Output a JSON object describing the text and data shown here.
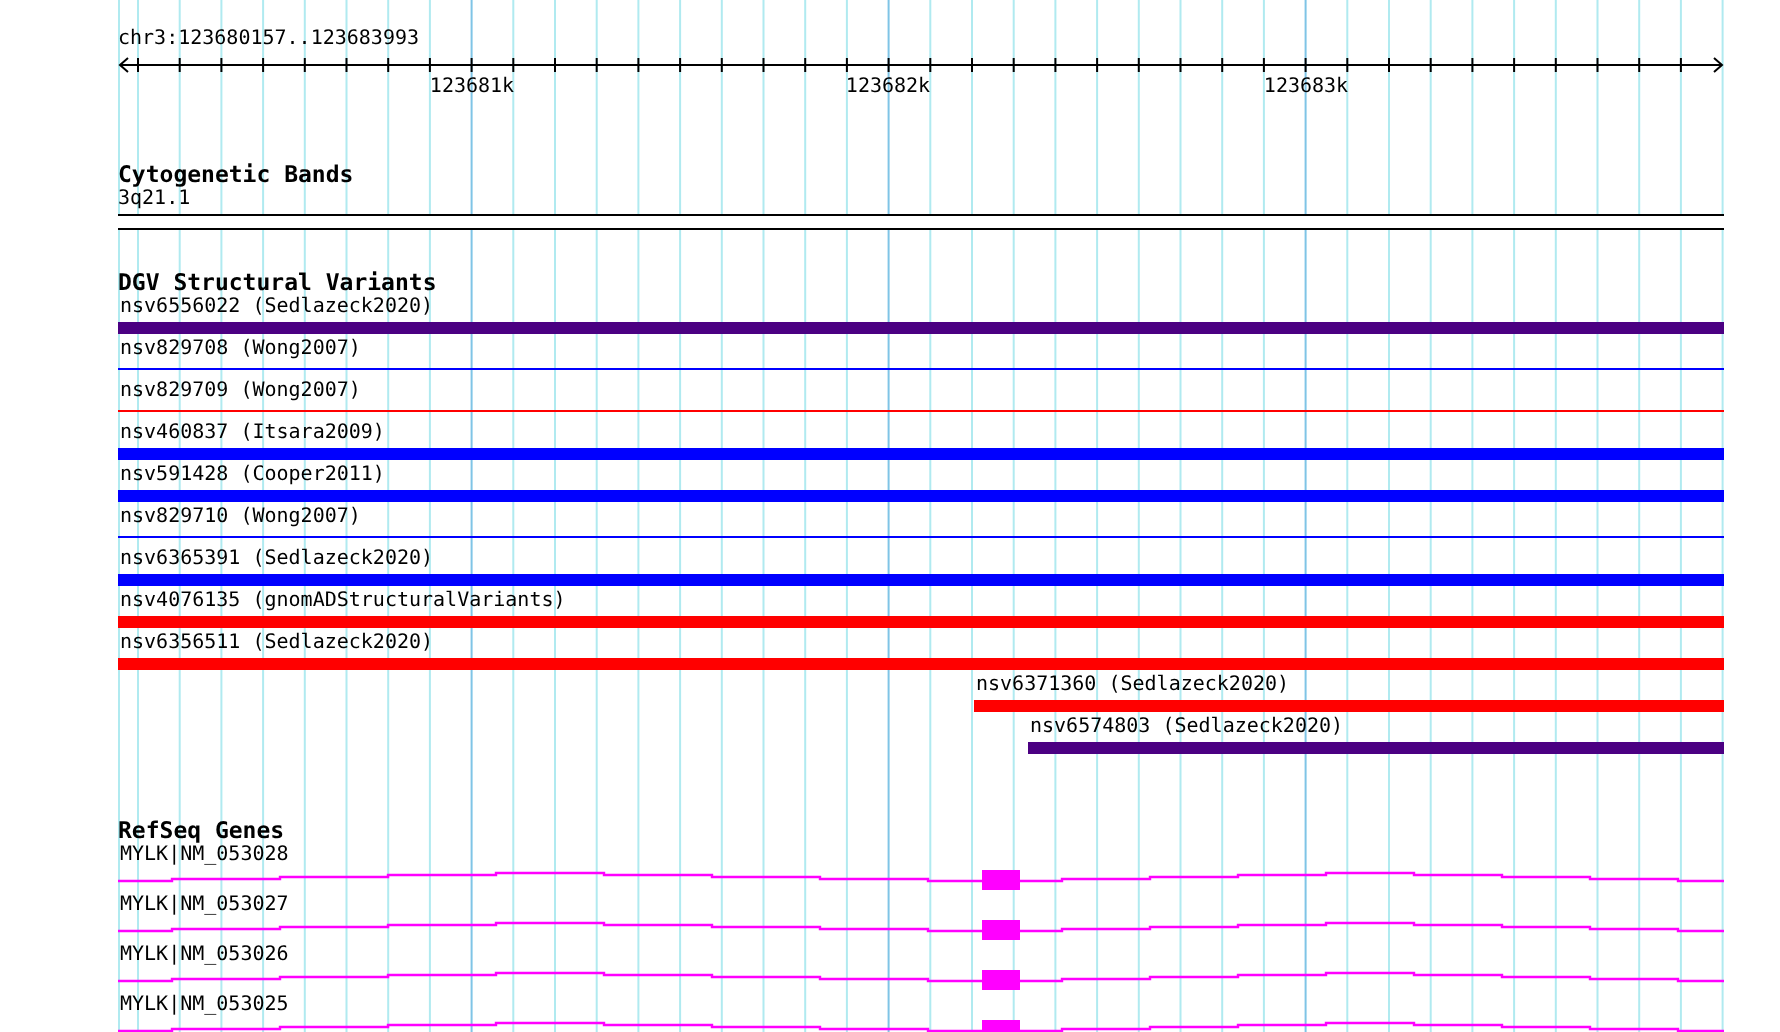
{
  "ruler": {
    "range_label": "chr3:123680157..123683993",
    "ticks": [
      "123681k",
      "123682k",
      "123683k"
    ]
  },
  "tracks": [
    {
      "kind": "bands",
      "title": "Cytogenetic Bands",
      "features": [
        {
          "label": "3q21.1"
        }
      ]
    },
    {
      "kind": "variants",
      "title": "DGV Structural Variants",
      "features": [
        {
          "label": "nsv6556022 (Sedlazeck2020)",
          "kind": "bar",
          "color": "#4b0082"
        },
        {
          "label": "nsv829708 (Wong2007)",
          "kind": "line",
          "color": "#0000ff"
        },
        {
          "label": "nsv829709 (Wong2007)",
          "kind": "line",
          "color": "#ff0000"
        },
        {
          "label": "nsv460837 (Itsara2009)",
          "kind": "bar",
          "color": "#0000ff"
        },
        {
          "label": "nsv591428 (Cooper2011)",
          "kind": "bar",
          "color": "#0000ff"
        },
        {
          "label": "nsv829710 (Wong2007)",
          "kind": "line",
          "color": "#0000ff"
        },
        {
          "label": "nsv6365391 (Sedlazeck2020)",
          "kind": "bar",
          "color": "#0000ff"
        },
        {
          "label": "nsv4076135 (gnomADStructuralVariants)",
          "kind": "bar",
          "color": "#ff0000"
        },
        {
          "label": "nsv6356511 (Sedlazeck2020)",
          "kind": "bar",
          "color": "#ff0000"
        },
        {
          "label": "nsv6371360 (Sedlazeck2020)",
          "kind": "partial",
          "color": "#ff0000"
        },
        {
          "label": "nsv6574803 (Sedlazeck2020)",
          "kind": "short",
          "color": "#4b0082"
        }
      ]
    },
    {
      "kind": "genes",
      "title": "RefSeq Genes",
      "features": [
        {
          "label": "MYLK|NM_053028"
        },
        {
          "label": "MYLK|NM_053027"
        },
        {
          "label": "MYLK|NM_053026"
        },
        {
          "label": "MYLK|NM_053025"
        }
      ]
    }
  ]
}
